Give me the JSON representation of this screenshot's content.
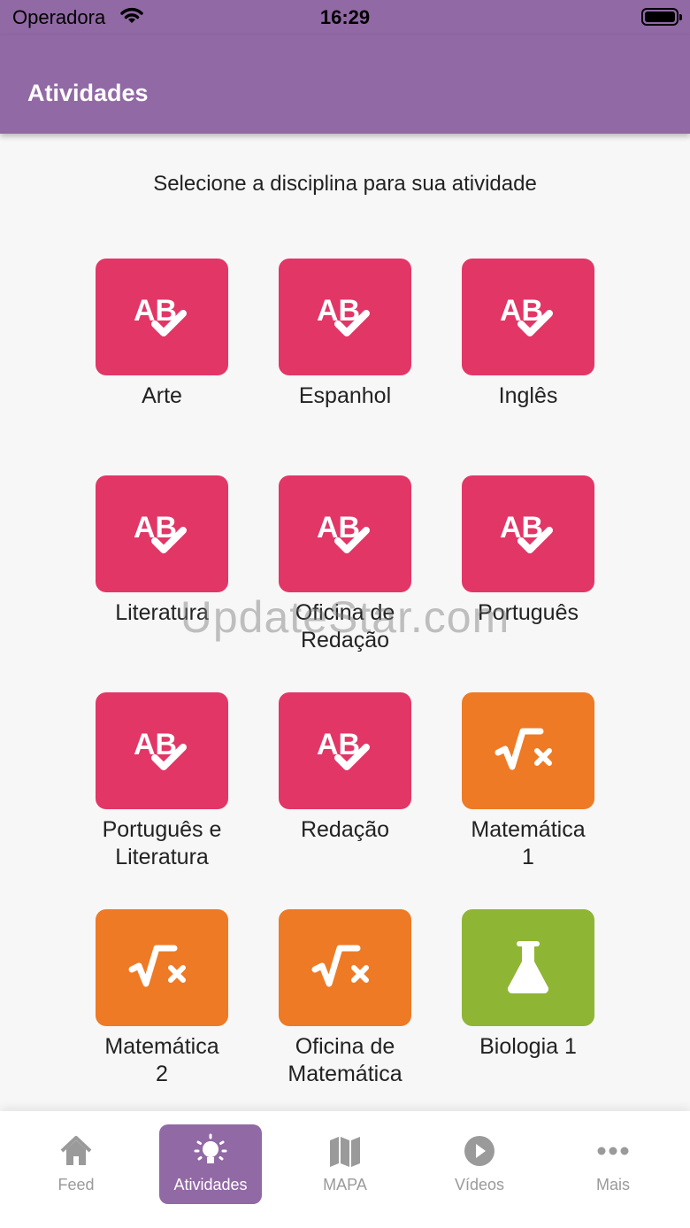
{
  "status_bar": {
    "carrier": "Operadora",
    "time": "16:29"
  },
  "header": {
    "title": "Atividades"
  },
  "subtitle": "Selecione a disciplina para sua atividade",
  "subjects": [
    {
      "label": "Arte",
      "icon": "spell-check-icon",
      "color": "#e23666"
    },
    {
      "label": "Espanhol",
      "icon": "spell-check-icon",
      "color": "#e23666"
    },
    {
      "label": "Inglês",
      "icon": "spell-check-icon",
      "color": "#e23666"
    },
    {
      "label": "Literatura",
      "icon": "spell-check-icon",
      "color": "#e23666"
    },
    {
      "label": "Oficina de\nRedação",
      "icon": "spell-check-icon",
      "color": "#e23666"
    },
    {
      "label": "Português",
      "icon": "spell-check-icon",
      "color": "#e23666"
    },
    {
      "label": "Português e\nLiteratura",
      "icon": "spell-check-icon",
      "color": "#e23666"
    },
    {
      "label": "Redação",
      "icon": "spell-check-icon",
      "color": "#e23666"
    },
    {
      "label": "Matemática\n1",
      "icon": "square-root-icon",
      "color": "#ee7a25"
    },
    {
      "label": "Matemática\n2",
      "icon": "square-root-icon",
      "color": "#ee7a25"
    },
    {
      "label": "Oficina de\nMatemática",
      "icon": "square-root-icon",
      "color": "#ee7a25"
    },
    {
      "label": "Biologia 1",
      "icon": "flask-icon",
      "color": "#8fb534"
    }
  ],
  "watermark": "UpdateStar.com",
  "tabs": [
    {
      "label": "Feed",
      "icon": "home-icon",
      "active": false
    },
    {
      "label": "Atividades",
      "icon": "lightbulb-icon",
      "active": true
    },
    {
      "label": "MAPA",
      "icon": "map-icon",
      "active": false
    },
    {
      "label": "Vídeos",
      "icon": "play-circle-icon",
      "active": false
    },
    {
      "label": "Mais",
      "icon": "more-icon",
      "active": false
    }
  ]
}
